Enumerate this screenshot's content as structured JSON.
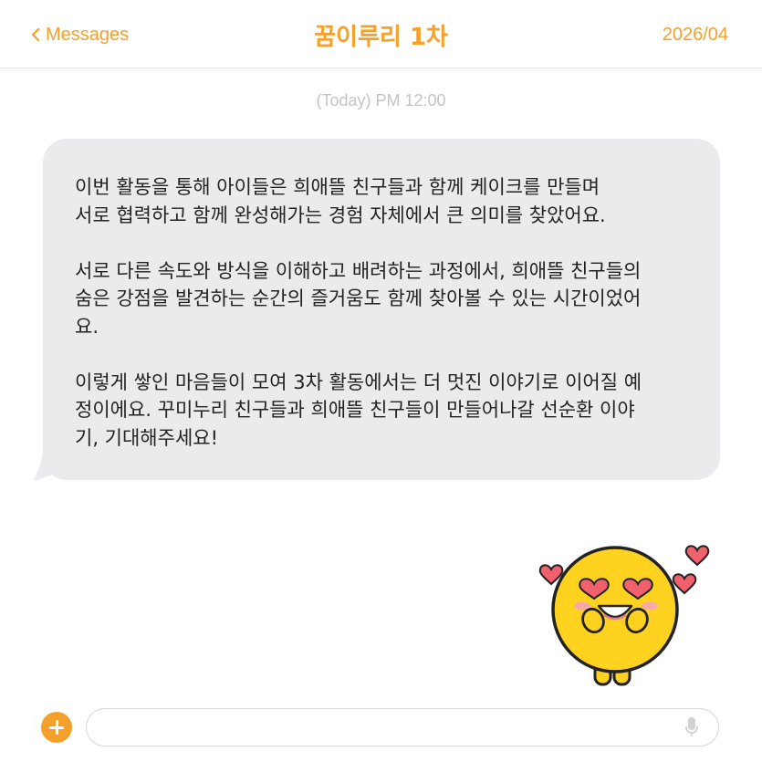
{
  "header": {
    "back_label": "Messages",
    "title": "꿈이루리 1차",
    "date": "2026/04"
  },
  "conversation": {
    "timestamp": "(Today) PM 12:00",
    "message": {
      "paragraphs": [
        [
          "이번 활동을 통해 아이들은 희애뜰 친구들과 함께 케이크를 만들며",
          "서로 협력하고 함께 완성해가는 경험 자체에서 큰 의미를 찾았어요."
        ],
        [
          "서로 다른 속도와 방식을 이해하고 배려하는 과정에서, 희애뜰 친구들의",
          "숨은 강점을 발견하는 순간의 즐거움도 함께 찾아볼 수 있는 시간이었어",
          "요."
        ],
        [
          "이렇게 쌓인 마음들이 모여 3차 활동에서는 더 멋진 이야기로 이어질 예",
          "정이에요. 꾸미누리 친구들과 희애뜰 친구들이 만들어나갈 선순환 이야",
          "기, 기대해주세요!"
        ]
      ]
    },
    "sticker": "heart-eyes-emoji-sticker"
  },
  "composer": {
    "add_icon": "plus-circle-icon",
    "input_value": "",
    "mic_icon": "microphone-icon"
  },
  "colors": {
    "accent": "#f5a02a",
    "bubble": "#ebebed",
    "sticker_yellow": "#ffd21f",
    "heart": "#f0616d"
  }
}
